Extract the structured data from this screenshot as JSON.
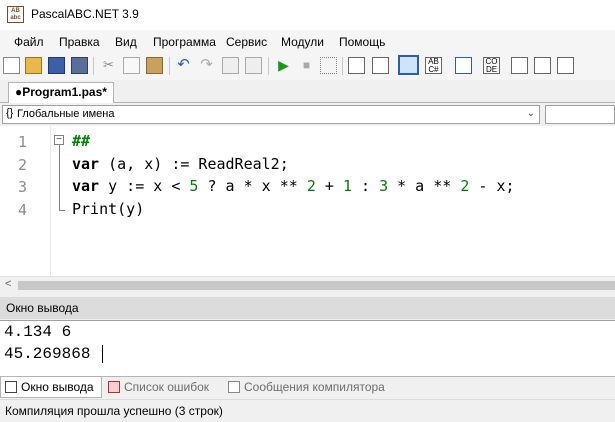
{
  "window": {
    "title": "PascalABC.NET 3.9",
    "icon_text": "AB\nabc"
  },
  "menu": [
    "Файл",
    "Правка",
    "Вид",
    "Программа",
    "Сервис",
    "Модули",
    "Помощь"
  ],
  "toolbar": {
    "buttons": [
      "new-file-icon",
      "open-folder-icon",
      "save-icon",
      "save-all-icon",
      "cut-icon",
      "copy-icon",
      "paste-icon",
      "undo-icon",
      "redo-icon",
      "navigate-back-icon",
      "navigate-forward-icon",
      "run-icon",
      "stop-icon",
      "debug-icon",
      "step-icon",
      "output-window-icon",
      "csharp-icon",
      "document-icon",
      "code-icon",
      "toggle-comment-icon",
      "format-code-icon",
      "debug-run-icon"
    ]
  },
  "editor_tab": {
    "label": "●Program1.pas*"
  },
  "scope": {
    "glyph": "{}",
    "label": "Глобальные имена"
  },
  "code": {
    "line_numbers": [
      "1",
      "2",
      "3",
      "4"
    ],
    "lines": [
      [
        {
          "t": "##",
          "c": "cmt"
        }
      ],
      [
        {
          "t": "var",
          "c": "kw"
        },
        {
          "t": " (a, x) := ReadReal2;",
          "c": ""
        }
      ],
      [
        {
          "t": "var",
          "c": "kw"
        },
        {
          "t": " y := x < ",
          "c": ""
        },
        {
          "t": "5",
          "c": "num"
        },
        {
          "t": " ? a * x ** ",
          "c": ""
        },
        {
          "t": "2",
          "c": "num"
        },
        {
          "t": " + ",
          "c": ""
        },
        {
          "t": "1",
          "c": "num"
        },
        {
          "t": " : ",
          "c": ""
        },
        {
          "t": "3",
          "c": "num"
        },
        {
          "t": " * a ** ",
          "c": ""
        },
        {
          "t": "2",
          "c": "num"
        },
        {
          "t": " - x;",
          "c": ""
        }
      ],
      [
        {
          "t": "Print(y)",
          "c": ""
        }
      ]
    ]
  },
  "output_panel": {
    "title": "Окно вывода",
    "lines": [
      "4.134 6",
      "45.269868"
    ]
  },
  "bottom_tabs": [
    {
      "label": "Окно вывода",
      "active": true,
      "icon": "output-icon"
    },
    {
      "label": "Список ошибок",
      "active": false,
      "icon": "error-list-icon"
    },
    {
      "label": "Сообщения компилятора",
      "active": false,
      "icon": "compiler-messages-icon"
    }
  ],
  "status": {
    "text": "Компиляция прошла успешно (3 строк)"
  }
}
